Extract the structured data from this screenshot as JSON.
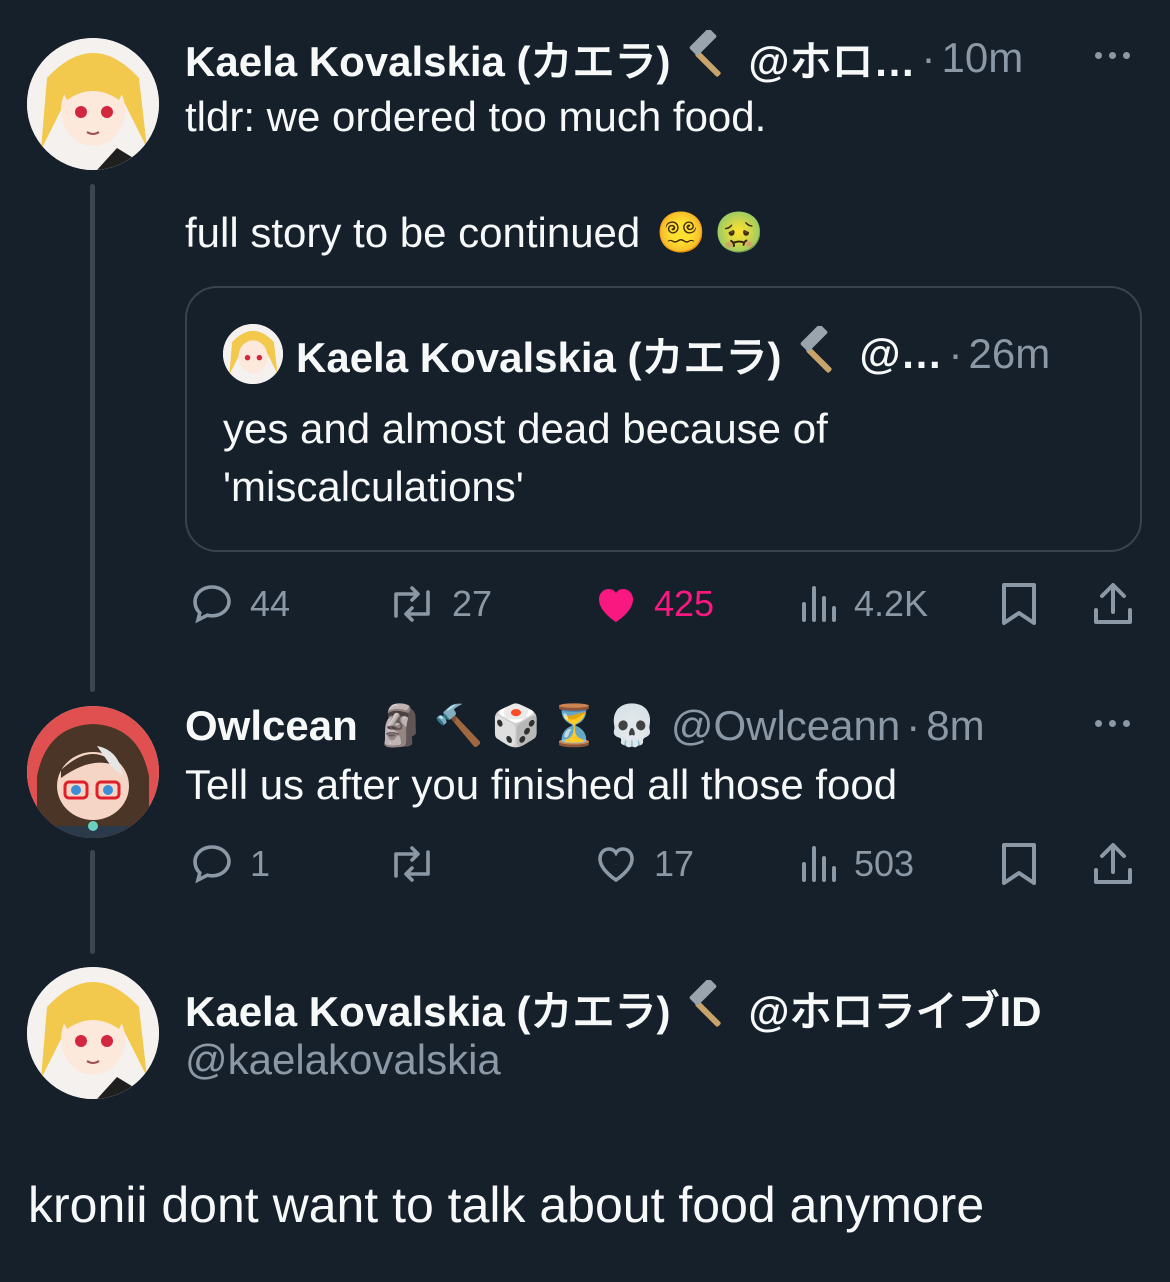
{
  "tweet1": {
    "name": "Kaela Kovalskia (カエラ)",
    "handle": "@ホロ…",
    "dot": "·",
    "time": "10m",
    "line1": "tldr: we ordered too much food.",
    "line2": "full story to be continued",
    "emojis": [
      "😵‍💫",
      "🤢"
    ],
    "quote": {
      "name": "Kaela Kovalskia (カエラ)",
      "handle": "@…",
      "dot": "·",
      "time": "26m",
      "line1": "yes and almost dead because of",
      "line2": "'miscalculations'"
    },
    "actions": {
      "replies": "44",
      "retweets": "27",
      "likes": "425",
      "views": "4.2K"
    }
  },
  "tweet2": {
    "name": "Owlcean",
    "badges": [
      "🗿",
      "🔨",
      "🎲",
      "⏳",
      "💀"
    ],
    "handle": "@Owlceann",
    "dot": "·",
    "time": "8m",
    "text": "Tell us after you finished all those food",
    "actions": {
      "replies": "1",
      "retweets": "",
      "likes": "17",
      "views": "503"
    }
  },
  "tweet3": {
    "name": "Kaela Kovalskia (カエラ)",
    "affiliation": "@ホロライブID",
    "handle": "@kaelakovalskia",
    "text": "kronii dont want to talk about food anymore"
  },
  "colors": {
    "background": "#15202b",
    "text": "#f7f9f9",
    "muted": "#8b98a5",
    "like_active": "#f91880",
    "border": "#38444d"
  },
  "icons": [
    "hammer-icon",
    "more-icon",
    "reply-icon",
    "retweet-icon",
    "heart-icon",
    "views-icon",
    "bookmark-icon",
    "share-icon"
  ]
}
